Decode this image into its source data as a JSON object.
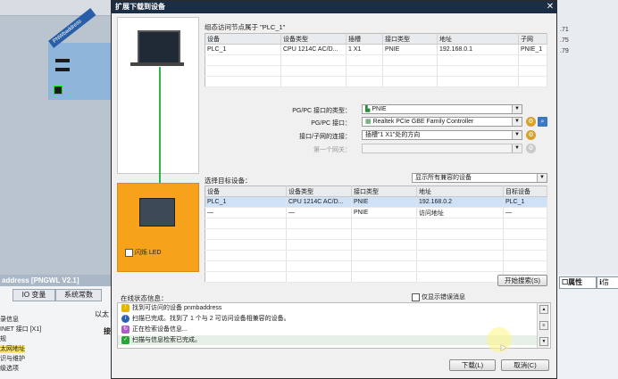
{
  "background": {
    "device_tag": "PNWbaddress",
    "right_values": [
      ".71",
      ".75",
      ".79"
    ],
    "bottom_panel_title": "address [PNGWL V2.1]",
    "tabs": [
      "IO 变量",
      "系统常数"
    ],
    "side_text": "以太",
    "side_text2": "接",
    "nav_items": [
      "录信息",
      "INET 接口 [X1]",
      "规",
      "太网地址",
      "识与维护",
      "级选项"
    ],
    "right_tab": "属性",
    "right_tab2": "信"
  },
  "dialog": {
    "title": "扩展下载到设备",
    "close": "✕",
    "node_header": "组态访问节点属于 \"PLC_1\"",
    "node_table": {
      "columns": [
        "设备",
        "设备类型",
        "插槽",
        "接口类型",
        "地址",
        "子网"
      ],
      "rows": [
        [
          "PLC_1",
          "CPU 1214C AC/D...",
          "1 X1",
          "PNIE",
          "192.168.0.1",
          "PNIE_1"
        ]
      ]
    },
    "form": {
      "pgpc_type_label": "PG/PC 接口的类型：",
      "pgpc_type_value": "PNIE",
      "pgpc_iface_label": "PG/PC 接口：",
      "pgpc_iface_value": "Realtek PCIe GBE Family Controller",
      "subnet_conn_label": "接口/子网的连接：",
      "subnet_conn_value": "插槽\"1 X1\"处的方向",
      "gateway_label": "第一个网关：",
      "gateway_value": ""
    },
    "target_label": "选择目标设备：",
    "target_filter": "显示所有兼容的设备",
    "target_table": {
      "columns": [
        "设备",
        "设备类型",
        "接口类型",
        "地址",
        "目标设备"
      ],
      "rows": [
        [
          "PLC_1",
          "CPU 1214C AC/D...",
          "PNIE",
          "192.168.0.2",
          "PLC_1"
        ],
        [
          "—",
          "—",
          "PNIE",
          "访问地址",
          "—"
        ]
      ]
    },
    "flash_led": "闪烁 LED",
    "start_search": "开始搜索(S)",
    "status_label": "在线状态信息：",
    "only_errors": "仅显示错误消息",
    "status_messages": [
      {
        "icon": "warning-icon",
        "text": "找到可访问的设备 pnmbaddress"
      },
      {
        "icon": "info-icon",
        "text": "扫描已完成。找到了 1 个与 2 可访问设备相兼容的设备。"
      },
      {
        "icon": "progress-icon",
        "text": "正在检索设备信息..."
      },
      {
        "icon": "check-icon",
        "text": "扫描与信息检索已完成。"
      }
    ],
    "load_button": "下载(L)",
    "cancel_button": "取消(C)"
  },
  "colors": {
    "title_bar": "#1b2e44",
    "device_panel": "#f6a21b",
    "selection": "#cfe1f7",
    "link_line": "#2db44a"
  }
}
